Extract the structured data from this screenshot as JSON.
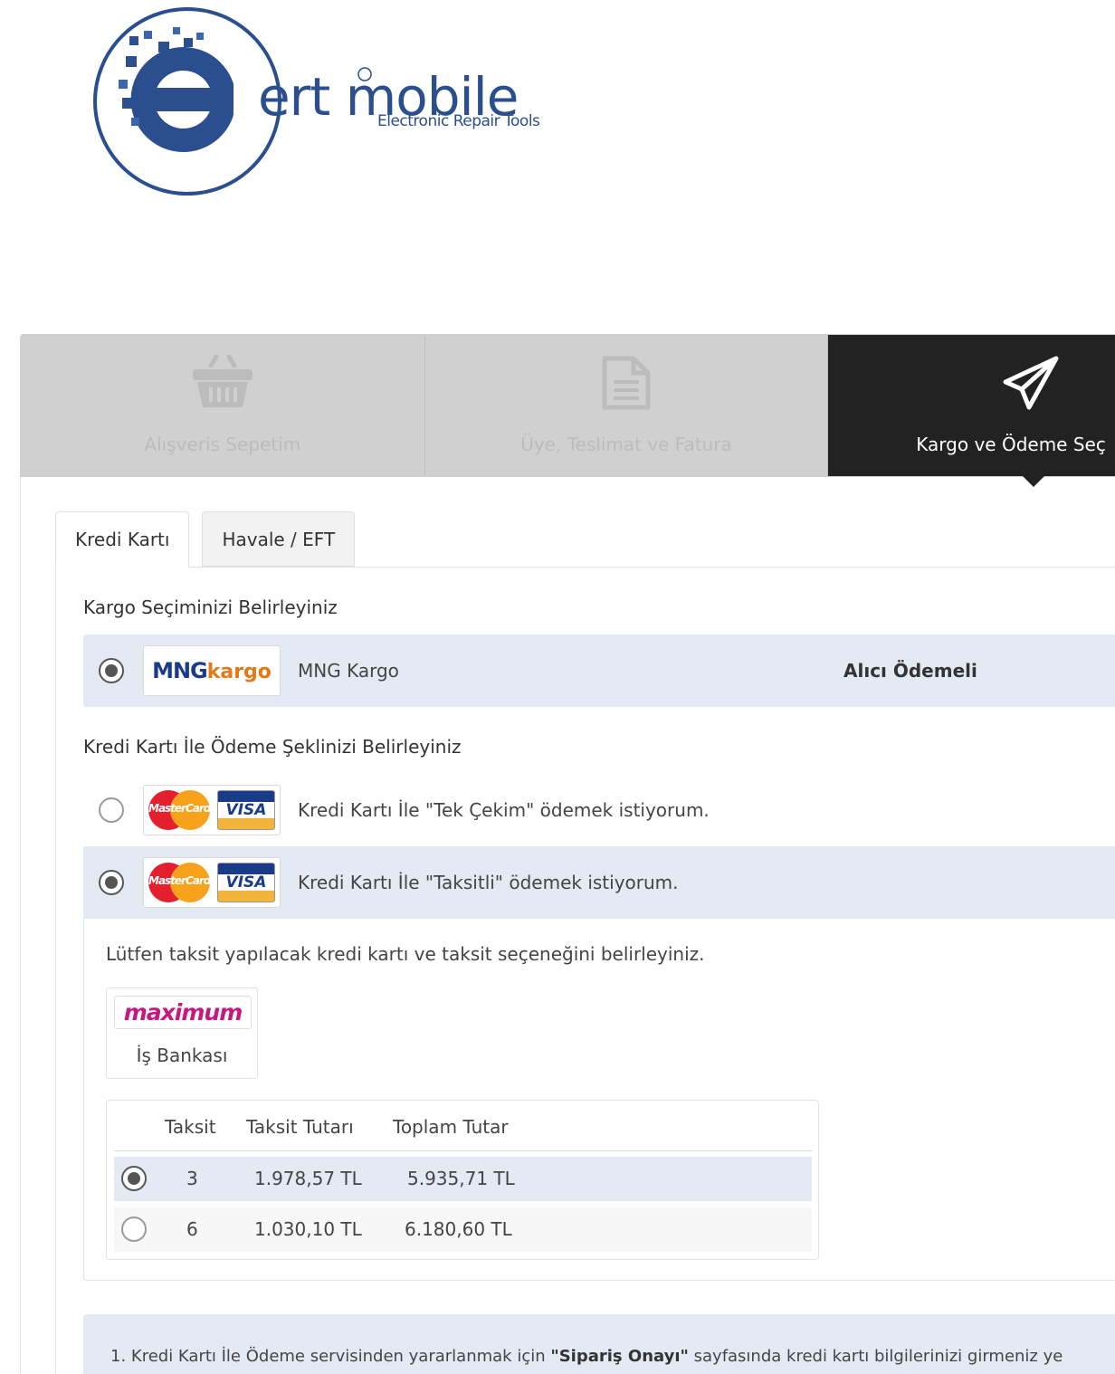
{
  "logo": {
    "brand": "ert mobile",
    "tagline": "Electronic Repair Tools"
  },
  "steps": [
    {
      "label": "Alışveris Sepetim",
      "icon": "basket-icon",
      "active": false
    },
    {
      "label": "Üye, Teslimat ve Fatura",
      "icon": "document-icon",
      "active": false
    },
    {
      "label": "Kargo ve Ödeme Seç",
      "icon": "paper-plane-icon",
      "active": true
    }
  ],
  "tabs": [
    {
      "label": "Kredi Kartı",
      "active": true
    },
    {
      "label": "Havale / EFT",
      "active": false
    }
  ],
  "cargo": {
    "title": "Kargo Seçiminizi Belirleyiniz",
    "option": {
      "logo_main": "MNG",
      "logo_sub": "kargo",
      "name": "MNG Kargo",
      "payment": "Alıcı Ödemeli",
      "selected": true
    }
  },
  "payment": {
    "title": "Kredi Kartı İle Ödeme Şeklinizi Belirleyiniz",
    "options": [
      {
        "label": "Kredi Kartı İle \"Tek Çekim\" ödemek istiyorum.",
        "selected": false
      },
      {
        "label": "Kredi Kartı İle \"Taksitli\" ödemek istiyorum.",
        "selected": true
      }
    ],
    "card_logos": {
      "mastercard": "MasterCard",
      "visa": "VISA"
    }
  },
  "installments": {
    "note": "Lütfen taksit yapılacak kredi kartı ve taksit seçeneğini belirleyiniz.",
    "bank": {
      "logo": "maximum",
      "name": "İş Bankası"
    },
    "headers": [
      "Taksit",
      "Taksit Tutarı",
      "Toplam Tutar"
    ],
    "rows": [
      {
        "count": "3",
        "amount": "1.978,57 TL",
        "total": "5.935,71 TL",
        "selected": true
      },
      {
        "count": "6",
        "amount": "1.030,10 TL",
        "total": "6.180,60 TL",
        "selected": false
      }
    ]
  },
  "info": {
    "prefix": "1. Kredi Kartı İle Ödeme servisinden yararlanmak için ",
    "bold": "\"Sipariş Onayı\"",
    "suffix": " sayfasında kredi kartı bilgilerinizi girmeniz ye"
  },
  "colors": {
    "accent_bg": "#e3eaf3",
    "active_step": "#222222",
    "inactive_step": "#d0d0d0",
    "logo_blue": "#2b4e8e"
  }
}
